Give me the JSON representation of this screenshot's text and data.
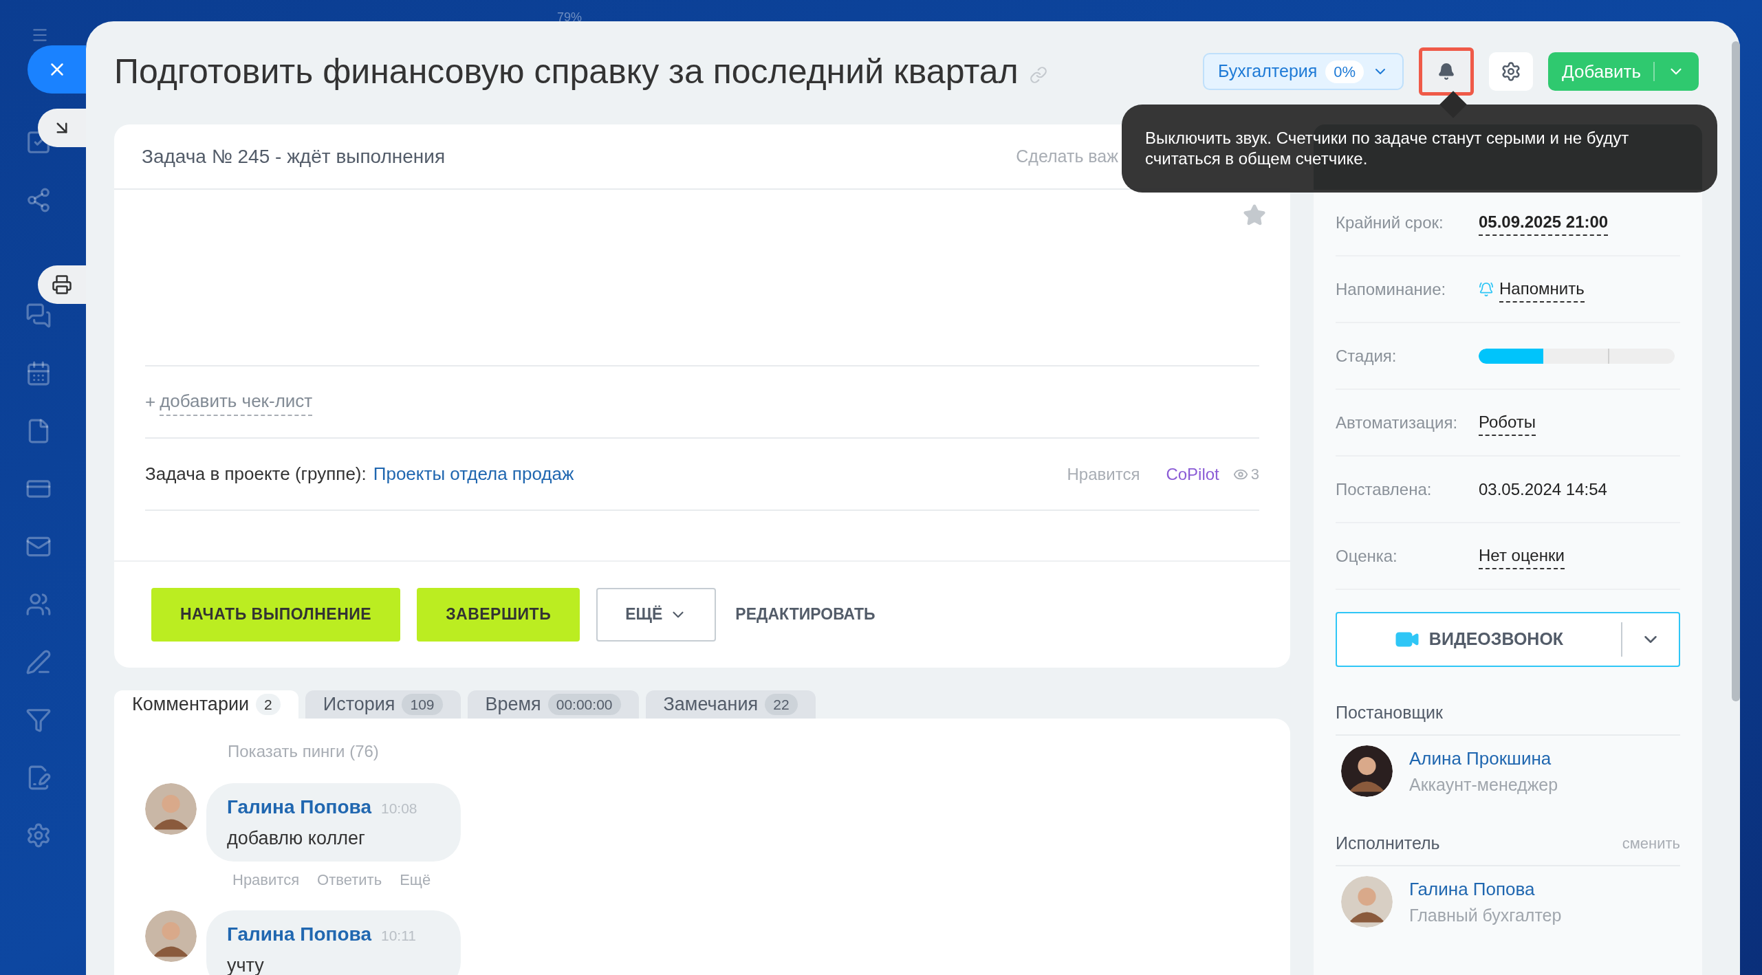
{
  "backdrop_text": "79%",
  "title": "Подготовить финансовую справку за последний квартал",
  "header": {
    "group": "Бухгалтерия",
    "group_percent": "0%",
    "mute_highlighted": true,
    "add_button": "Добавить"
  },
  "tooltip": "Выключить звук. Счетчики по задаче станут серыми и не будут считаться в общем счетчике.",
  "task": {
    "status": "Задача № 245 - ждёт выполнения",
    "make_important": "Сделать важ",
    "starred": false,
    "checklist_plus": "+",
    "checklist_link": "добавить чек-лист",
    "project_label": "Задача в проекте (группе):",
    "project_link": "Проекты отдела продаж",
    "like": "Нравится",
    "copilot": "CoPilot",
    "views": "3"
  },
  "buttons": [
    {
      "label": "НАЧАТЬ ВЫПОЛНЕНИЕ",
      "kind": "primary"
    },
    {
      "label": "ЗАВЕРШИТЬ",
      "kind": "primary"
    },
    {
      "label": "ЕЩЁ",
      "kind": "dropdown"
    },
    {
      "label": "РЕДАКТИРОВАТЬ",
      "kind": "link"
    }
  ],
  "tabs": [
    {
      "label": "Комментарии",
      "count": "2",
      "selected": true
    },
    {
      "label": "История",
      "count": "109",
      "selected": false
    },
    {
      "label": "Время",
      "count": "00:00:00",
      "selected": false
    },
    {
      "label": "Замечания",
      "count": "22",
      "selected": false
    }
  ],
  "show_pings": "Показать пинги (76)",
  "comments": [
    {
      "author": "Галина Попова",
      "time": "10:08",
      "text": "добавлю коллег",
      "actions": [
        "Нравится",
        "Ответить",
        "Ещё"
      ]
    },
    {
      "author": "Галина Попова",
      "time": "10:11",
      "text": "учту"
    }
  ],
  "fields": [
    {
      "label": "Крайний срок:",
      "value": "05.09.2025 21:00",
      "kind": "date"
    },
    {
      "label": "Напоминание:",
      "value": "Напомнить",
      "kind": "reminder"
    },
    {
      "label": "Стадия:",
      "kind": "stage",
      "level": 0.33
    },
    {
      "label": "Автоматизация:",
      "value": "Роботы",
      "kind": "link"
    },
    {
      "label": "Поставлена:",
      "value": "03.05.2024 14:54",
      "kind": "text"
    },
    {
      "label": "Оценка:",
      "value": "Нет оценки",
      "kind": "link"
    }
  ],
  "video_call": "ВИДЕОЗВОНОК",
  "people": [
    {
      "role": "Постановщик",
      "name": "Алина Прокшина",
      "position": "Аккаунт-менеджер"
    },
    {
      "role": "Исполнитель",
      "action": "сменить",
      "name": "Галина Попова",
      "position": "Главный бухгалтер"
    }
  ]
}
